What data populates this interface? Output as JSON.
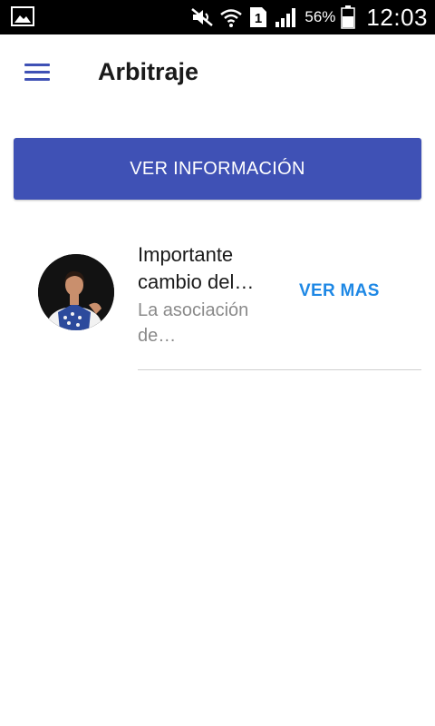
{
  "status_bar": {
    "battery_percent": "56%",
    "time": "12:03",
    "sim_slot": "1",
    "icons": [
      "gallery-icon",
      "mute-icon",
      "wifi-icon",
      "sim-icon",
      "signal-icon",
      "battery-icon"
    ]
  },
  "app_bar": {
    "title": "Arbitraje",
    "menu_icon": "hamburger-menu-icon",
    "accent_color": "#3f51b5"
  },
  "info_button": {
    "label": "VER INFORMACIÓN",
    "color": "#3f51b5"
  },
  "news": [
    {
      "title": "Importante cambio del…",
      "description": "La asociación de…",
      "action_label": "VER MAS",
      "action_color": "#1e88e5"
    }
  ]
}
